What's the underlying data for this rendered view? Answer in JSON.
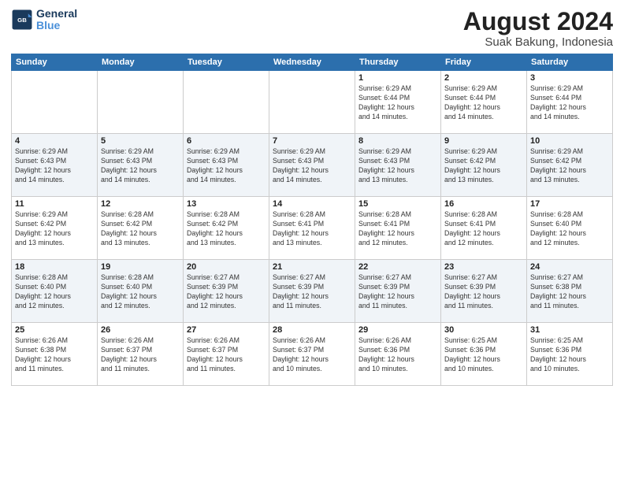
{
  "header": {
    "logo_text_general": "General",
    "logo_text_blue": "Blue",
    "main_title": "August 2024",
    "subtitle": "Suak Bakung, Indonesia"
  },
  "days_of_week": [
    "Sunday",
    "Monday",
    "Tuesday",
    "Wednesday",
    "Thursday",
    "Friday",
    "Saturday"
  ],
  "weeks": [
    [
      {
        "day": "",
        "info": ""
      },
      {
        "day": "",
        "info": ""
      },
      {
        "day": "",
        "info": ""
      },
      {
        "day": "",
        "info": ""
      },
      {
        "day": "1",
        "info": "Sunrise: 6:29 AM\nSunset: 6:44 PM\nDaylight: 12 hours\nand 14 minutes."
      },
      {
        "day": "2",
        "info": "Sunrise: 6:29 AM\nSunset: 6:44 PM\nDaylight: 12 hours\nand 14 minutes."
      },
      {
        "day": "3",
        "info": "Sunrise: 6:29 AM\nSunset: 6:44 PM\nDaylight: 12 hours\nand 14 minutes."
      }
    ],
    [
      {
        "day": "4",
        "info": "Sunrise: 6:29 AM\nSunset: 6:43 PM\nDaylight: 12 hours\nand 14 minutes."
      },
      {
        "day": "5",
        "info": "Sunrise: 6:29 AM\nSunset: 6:43 PM\nDaylight: 12 hours\nand 14 minutes."
      },
      {
        "day": "6",
        "info": "Sunrise: 6:29 AM\nSunset: 6:43 PM\nDaylight: 12 hours\nand 14 minutes."
      },
      {
        "day": "7",
        "info": "Sunrise: 6:29 AM\nSunset: 6:43 PM\nDaylight: 12 hours\nand 14 minutes."
      },
      {
        "day": "8",
        "info": "Sunrise: 6:29 AM\nSunset: 6:43 PM\nDaylight: 12 hours\nand 13 minutes."
      },
      {
        "day": "9",
        "info": "Sunrise: 6:29 AM\nSunset: 6:42 PM\nDaylight: 12 hours\nand 13 minutes."
      },
      {
        "day": "10",
        "info": "Sunrise: 6:29 AM\nSunset: 6:42 PM\nDaylight: 12 hours\nand 13 minutes."
      }
    ],
    [
      {
        "day": "11",
        "info": "Sunrise: 6:29 AM\nSunset: 6:42 PM\nDaylight: 12 hours\nand 13 minutes."
      },
      {
        "day": "12",
        "info": "Sunrise: 6:28 AM\nSunset: 6:42 PM\nDaylight: 12 hours\nand 13 minutes."
      },
      {
        "day": "13",
        "info": "Sunrise: 6:28 AM\nSunset: 6:42 PM\nDaylight: 12 hours\nand 13 minutes."
      },
      {
        "day": "14",
        "info": "Sunrise: 6:28 AM\nSunset: 6:41 PM\nDaylight: 12 hours\nand 13 minutes."
      },
      {
        "day": "15",
        "info": "Sunrise: 6:28 AM\nSunset: 6:41 PM\nDaylight: 12 hours\nand 12 minutes."
      },
      {
        "day": "16",
        "info": "Sunrise: 6:28 AM\nSunset: 6:41 PM\nDaylight: 12 hours\nand 12 minutes."
      },
      {
        "day": "17",
        "info": "Sunrise: 6:28 AM\nSunset: 6:40 PM\nDaylight: 12 hours\nand 12 minutes."
      }
    ],
    [
      {
        "day": "18",
        "info": "Sunrise: 6:28 AM\nSunset: 6:40 PM\nDaylight: 12 hours\nand 12 minutes."
      },
      {
        "day": "19",
        "info": "Sunrise: 6:28 AM\nSunset: 6:40 PM\nDaylight: 12 hours\nand 12 minutes."
      },
      {
        "day": "20",
        "info": "Sunrise: 6:27 AM\nSunset: 6:39 PM\nDaylight: 12 hours\nand 12 minutes."
      },
      {
        "day": "21",
        "info": "Sunrise: 6:27 AM\nSunset: 6:39 PM\nDaylight: 12 hours\nand 11 minutes."
      },
      {
        "day": "22",
        "info": "Sunrise: 6:27 AM\nSunset: 6:39 PM\nDaylight: 12 hours\nand 11 minutes."
      },
      {
        "day": "23",
        "info": "Sunrise: 6:27 AM\nSunset: 6:39 PM\nDaylight: 12 hours\nand 11 minutes."
      },
      {
        "day": "24",
        "info": "Sunrise: 6:27 AM\nSunset: 6:38 PM\nDaylight: 12 hours\nand 11 minutes."
      }
    ],
    [
      {
        "day": "25",
        "info": "Sunrise: 6:26 AM\nSunset: 6:38 PM\nDaylight: 12 hours\nand 11 minutes."
      },
      {
        "day": "26",
        "info": "Sunrise: 6:26 AM\nSunset: 6:37 PM\nDaylight: 12 hours\nand 11 minutes."
      },
      {
        "day": "27",
        "info": "Sunrise: 6:26 AM\nSunset: 6:37 PM\nDaylight: 12 hours\nand 11 minutes."
      },
      {
        "day": "28",
        "info": "Sunrise: 6:26 AM\nSunset: 6:37 PM\nDaylight: 12 hours\nand 10 minutes."
      },
      {
        "day": "29",
        "info": "Sunrise: 6:26 AM\nSunset: 6:36 PM\nDaylight: 12 hours\nand 10 minutes."
      },
      {
        "day": "30",
        "info": "Sunrise: 6:25 AM\nSunset: 6:36 PM\nDaylight: 12 hours\nand 10 minutes."
      },
      {
        "day": "31",
        "info": "Sunrise: 6:25 AM\nSunset: 6:36 PM\nDaylight: 12 hours\nand 10 minutes."
      }
    ]
  ]
}
